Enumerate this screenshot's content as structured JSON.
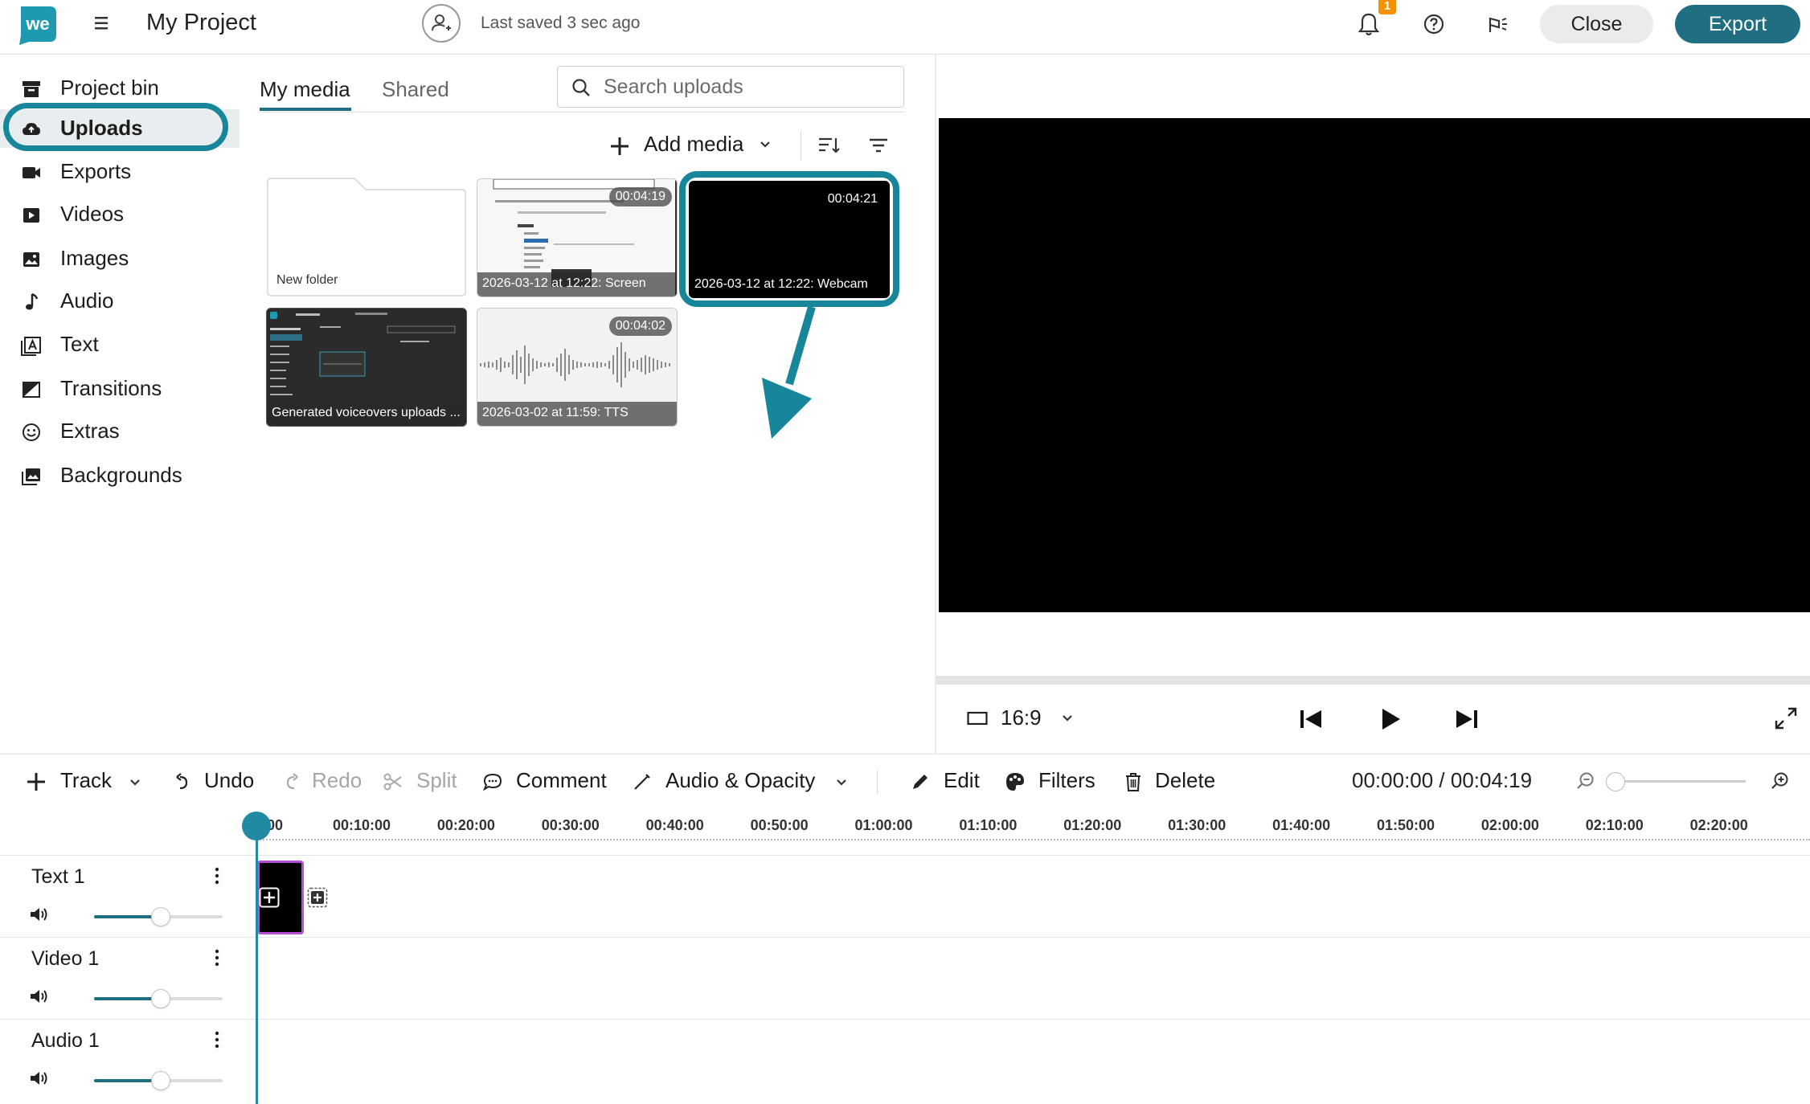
{
  "header": {
    "logo_text": "we",
    "project_title": "My Project",
    "saved_status": "Last saved 3 sec ago",
    "notification_count": "1",
    "close_label": "Close",
    "export_label": "Export"
  },
  "sidebar": {
    "items": [
      {
        "label": "Project bin",
        "icon": "archive-icon"
      },
      {
        "label": "Uploads",
        "icon": "cloud-upload-icon",
        "active": true
      },
      {
        "label": "Exports",
        "icon": "video-camera-icon"
      },
      {
        "label": "Videos",
        "icon": "play-square-icon"
      },
      {
        "label": "Images",
        "icon": "image-icon"
      },
      {
        "label": "Audio",
        "icon": "music-note-icon"
      },
      {
        "label": "Text",
        "icon": "text-a-icon"
      },
      {
        "label": "Transitions",
        "icon": "transition-icon"
      },
      {
        "label": "Extras",
        "icon": "smiley-icon"
      },
      {
        "label": "Backgrounds",
        "icon": "backgrounds-icon"
      }
    ]
  },
  "media": {
    "tabs": [
      "My media",
      "Shared"
    ],
    "active_tab": "My media",
    "search_placeholder": "Search uploads",
    "add_media_label": "Add media",
    "tiles": [
      {
        "kind": "folder",
        "caption": "New folder",
        "duration": ""
      },
      {
        "kind": "screen",
        "caption": "2026-03-12 at 12:22: Screen",
        "duration": "00:04:19"
      },
      {
        "kind": "webcam",
        "caption": "2026-03-12 at 12:22: Webcam",
        "duration": "00:04:21",
        "highlighted": true
      },
      {
        "kind": "screenshot",
        "caption": "Generated voiceovers uploads ...",
        "duration": ""
      },
      {
        "kind": "audio",
        "caption": "2026-03-02 at 11:59: TTS",
        "duration": "00:04:02"
      }
    ]
  },
  "preview": {
    "aspect_ratio": "16:9",
    "progress": 0
  },
  "timeline_toolbar": {
    "track_label": "Track",
    "undo_label": "Undo",
    "redo_label": "Redo",
    "split_label": "Split",
    "comment_label": "Comment",
    "audio_opacity_label": "Audio & Opacity",
    "edit_label": "Edit",
    "filters_label": "Filters",
    "delete_label": "Delete",
    "timecode": "00:00:00 / 00:04:19",
    "zoom_level": 0
  },
  "ruler": {
    "ticks": [
      "00",
      "00:10:00",
      "00:20:00",
      "00:30:00",
      "00:40:00",
      "00:50:00",
      "01:00:00",
      "01:10:00",
      "01:20:00",
      "01:30:00",
      "01:40:00",
      "01:50:00",
      "02:00:00",
      "02:10:00",
      "02:20:00"
    ]
  },
  "tracks": [
    {
      "name": "Text 1",
      "volume": 0.52
    },
    {
      "name": "Video 1",
      "volume": 0.52
    },
    {
      "name": "Audio 1",
      "volume": 0.52
    }
  ],
  "colors": {
    "accent": "#1f6e82",
    "highlight_ring": "#17859a",
    "playhead": "#1f8aa2",
    "clip_border": "#b64fd8",
    "badge": "#f39200"
  }
}
